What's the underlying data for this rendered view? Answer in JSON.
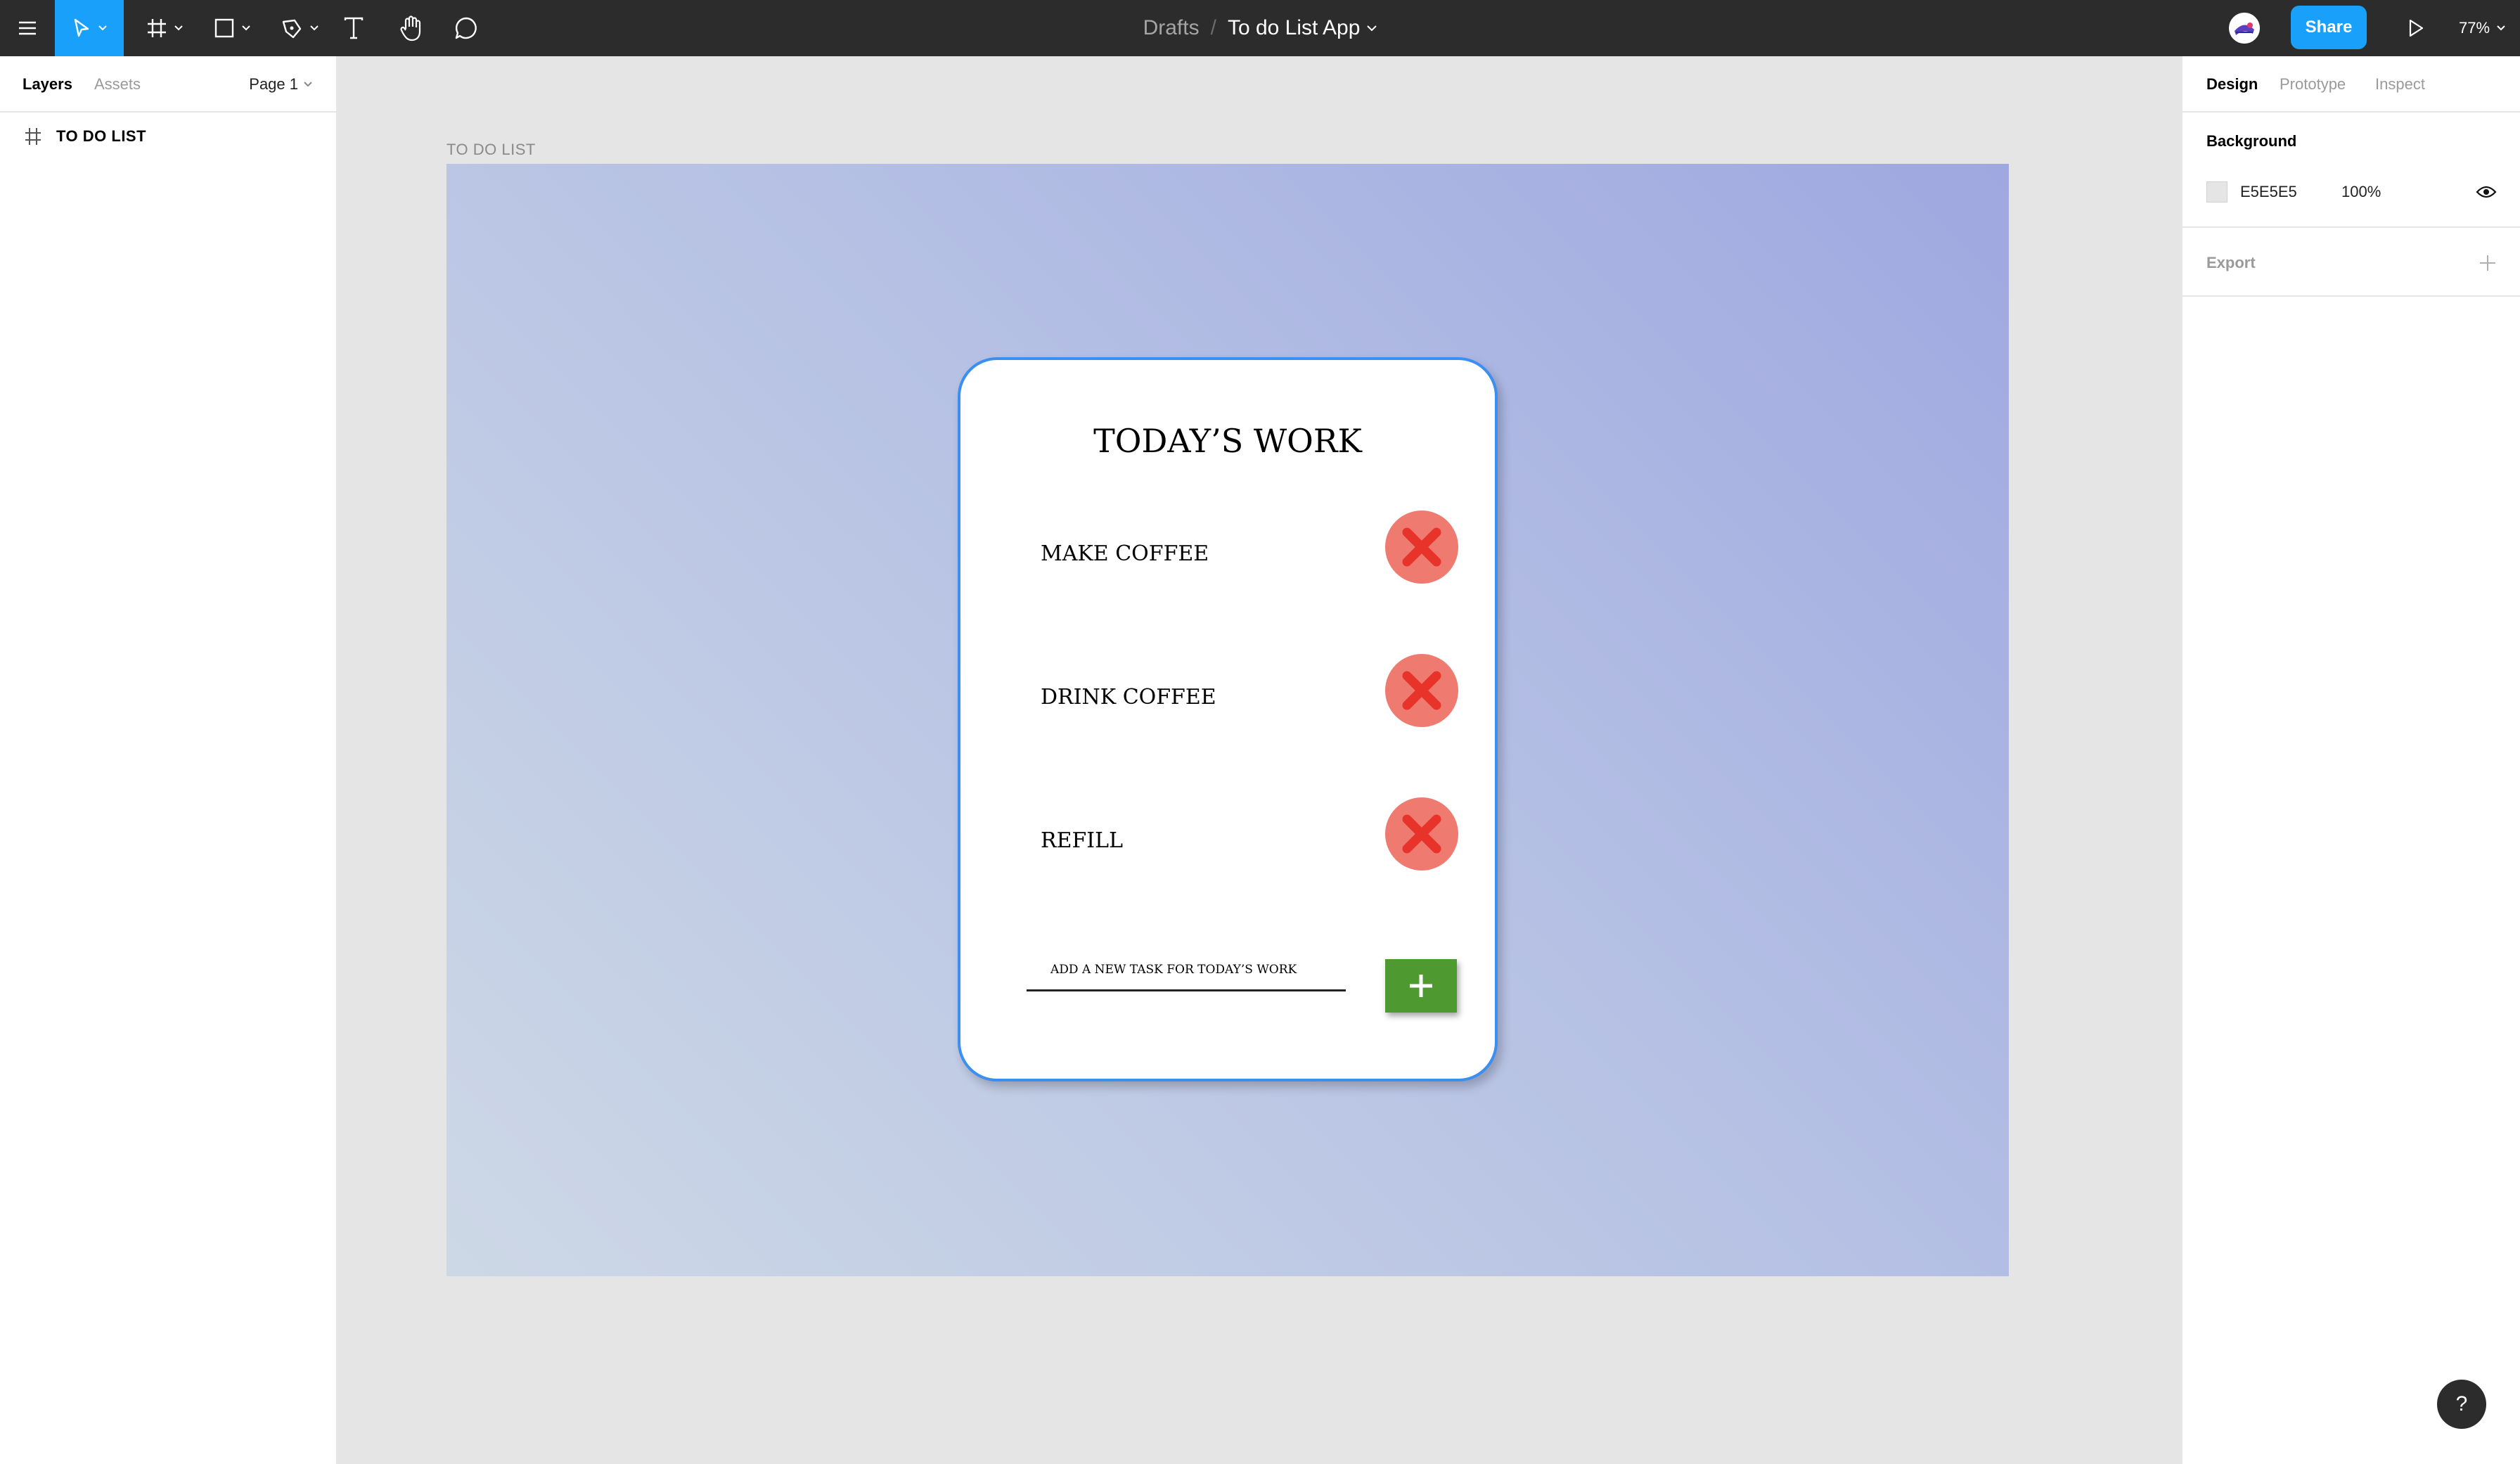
{
  "app": {
    "breadcrumb_drafts": "Drafts",
    "breadcrumb_separator": "/",
    "file_name": "To do List App",
    "share_label": "Share",
    "zoom_level": "77%"
  },
  "toolbar": {
    "icons": [
      "menu-icon",
      "move-tool-icon",
      "frame-tool-icon",
      "shape-tool-icon",
      "pen-tool-icon",
      "text-tool-icon",
      "hand-tool-icon",
      "comment-tool-icon"
    ],
    "accent_color": "#18a0fb"
  },
  "left_panel": {
    "tabs": [
      "Layers",
      "Assets"
    ],
    "page_selector": "Page 1",
    "layers": [
      {
        "name": "TO DO LIST",
        "icon": "frame-icon"
      }
    ]
  },
  "right_panel": {
    "tabs": [
      "Design",
      "Prototype",
      "Inspect"
    ],
    "background": {
      "title": "Background",
      "hex": "E5E5E5",
      "opacity": "100%"
    },
    "export_title": "Export"
  },
  "canvas": {
    "frame_label": "TO DO LIST",
    "card": {
      "title": "TODAY’S WORK",
      "tasks": [
        {
          "label": "MAKE COFFEE"
        },
        {
          "label": "DRINK COFFEE"
        },
        {
          "label": "REFILL"
        }
      ],
      "input_placeholder": "ADD A NEW TASK FOR TODAY’S WORK",
      "colors": {
        "card_border": "#3b8ff0",
        "delete_button": "#ef7a6f",
        "delete_x": "#e8332a",
        "add_button": "#4e9a31"
      }
    }
  },
  "help_label": "?"
}
